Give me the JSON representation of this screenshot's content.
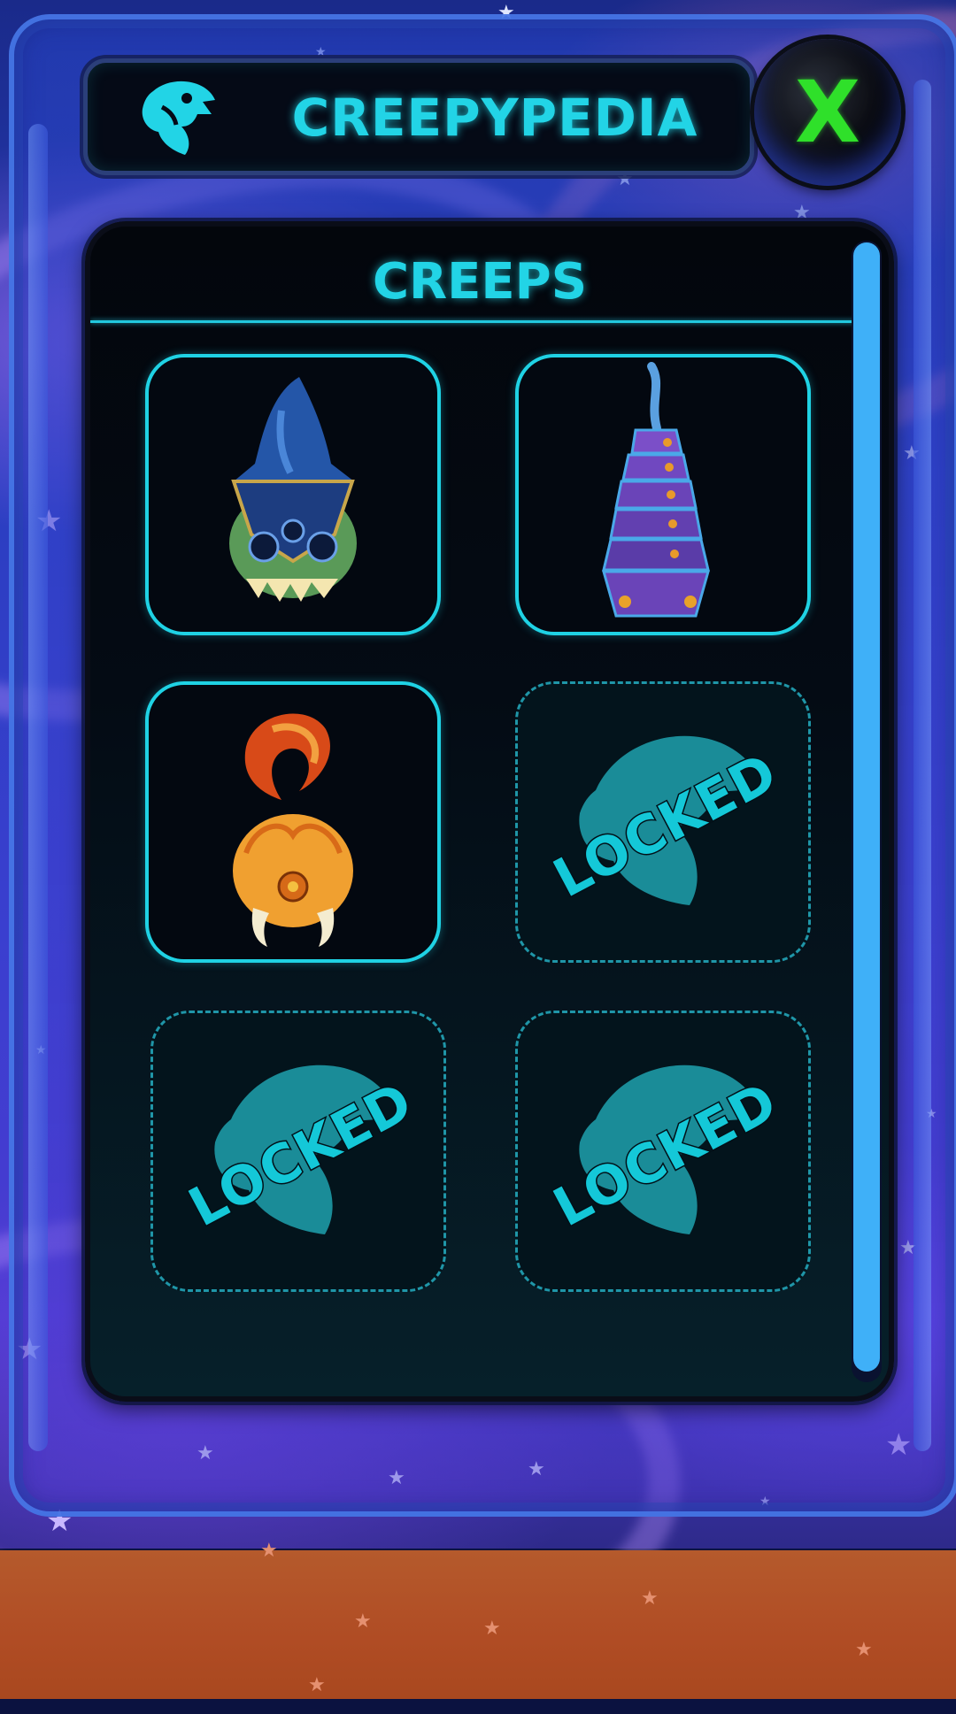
{
  "header": {
    "title": "CREEPYPEDIA",
    "logo_icon": "creep-head-logo-icon",
    "close_label": "X"
  },
  "panel": {
    "title": "CREEPS",
    "creeps": [
      {
        "status": "unlocked",
        "icon": "blue-flame-helmet-creep-icon"
      },
      {
        "status": "unlocked",
        "icon": "purple-tower-tentacle-creep-icon"
      },
      {
        "status": "unlocked",
        "icon": "orange-flame-pod-creep-icon"
      },
      {
        "status": "locked",
        "label": "LOCKED",
        "icon": "creep-silhouette-icon"
      },
      {
        "status": "locked",
        "label": "LOCKED",
        "icon": "creep-silhouette-icon"
      },
      {
        "status": "locked",
        "label": "LOCKED",
        "icon": "creep-silhouette-icon"
      }
    ]
  },
  "colors": {
    "accent_cyan": "#22d4e6",
    "close_green": "#2fe02a",
    "scrollbar": "#3fb0f8",
    "planet": "#b04c24"
  }
}
